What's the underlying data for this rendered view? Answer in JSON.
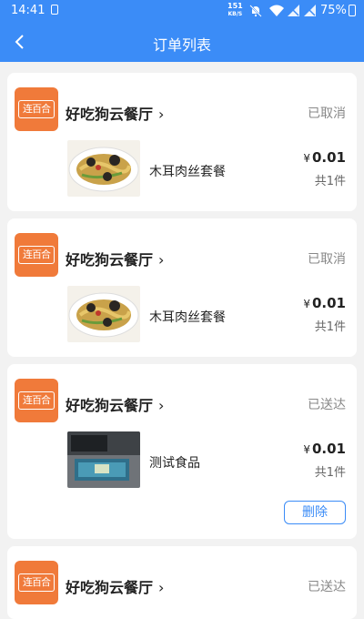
{
  "status_bar": {
    "time": "14:41",
    "net_speed_top": "151",
    "net_speed_bottom": "KB/S",
    "battery": "75%"
  },
  "header": {
    "title": "订单列表"
  },
  "orders": [
    {
      "store": "好吃狗云餐厅",
      "status": "已取消",
      "item_name": "木耳肉丝套餐",
      "currency": "¥",
      "price": "0.01",
      "qty": "共1件",
      "logo_text": "连百合"
    },
    {
      "store": "好吃狗云餐厅",
      "status": "已取消",
      "item_name": "木耳肉丝套餐",
      "currency": "¥",
      "price": "0.01",
      "qty": "共1件",
      "logo_text": "连百合"
    },
    {
      "store": "好吃狗云餐厅",
      "status": "已送达",
      "item_name": "测试食品",
      "currency": "¥",
      "price": "0.01",
      "qty": "共1件",
      "logo_text": "连百合",
      "action": "删除"
    },
    {
      "store": "好吃狗云餐厅",
      "status": "已送达",
      "logo_text": "连百合"
    }
  ],
  "icons": {
    "back": "chevron-left-icon",
    "store_arrow": "chevron-right-icon",
    "sim": "sim-icon",
    "mute": "bell-off-icon",
    "wifi": "wifi-icon",
    "signal": "signal-icon",
    "battery": "battery-icon"
  },
  "colors": {
    "primary": "#3b8cf7",
    "logo": "#f07a3a",
    "background": "#f2f2f2"
  }
}
